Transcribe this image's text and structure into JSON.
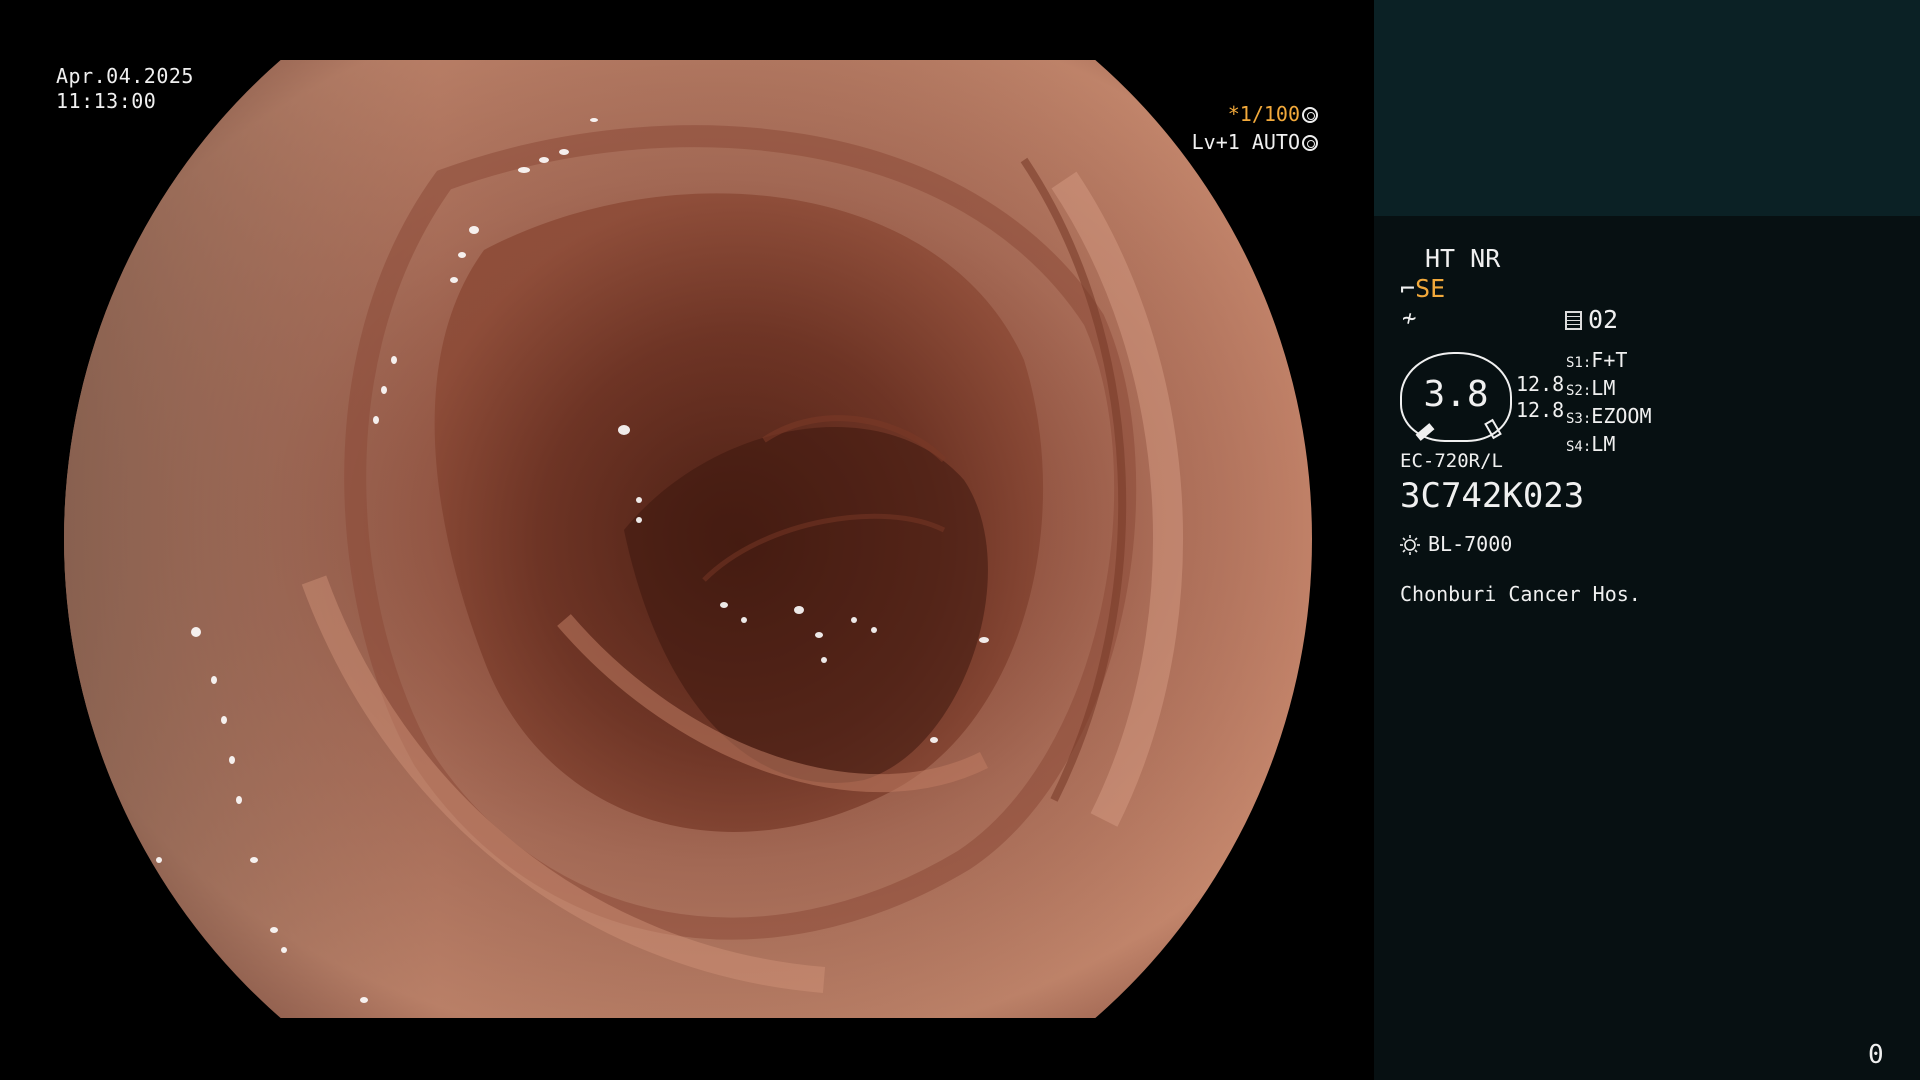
{
  "overlay": {
    "date": "Apr.04.2025",
    "time": "11:13:00",
    "shutter_speed": "*1/100",
    "shutter_mode": "Lv+1 AUTO"
  },
  "panel": {
    "ht_nr": "HT NR",
    "se_label": "SE",
    "memory_number": "02",
    "gauge_value": "3.8",
    "gauge_side_values": [
      "12.8",
      "12.8"
    ],
    "switches": [
      {
        "key": "S1:",
        "value": "F+T"
      },
      {
        "key": "S2:",
        "value": "LM"
      },
      {
        "key": "S3:",
        "value": "EZOOM"
      },
      {
        "key": "S4:",
        "value": "LM"
      }
    ],
    "scope_model": "EC-720R/L",
    "scope_serial": "3C742K023",
    "light_source": "BL-7000",
    "hospital": "Chonburi Cancer Hos.",
    "corner_number": "0"
  },
  "colors": {
    "panel_top": "#0b2125",
    "panel_bottom": "#071012",
    "accent_orange": "#f2a93b",
    "tissue": "#b5715a"
  },
  "icons": [
    "shutter-icon",
    "auto-icon",
    "scope-icon",
    "freeze-icon",
    "memory-icon",
    "light-icon"
  ]
}
